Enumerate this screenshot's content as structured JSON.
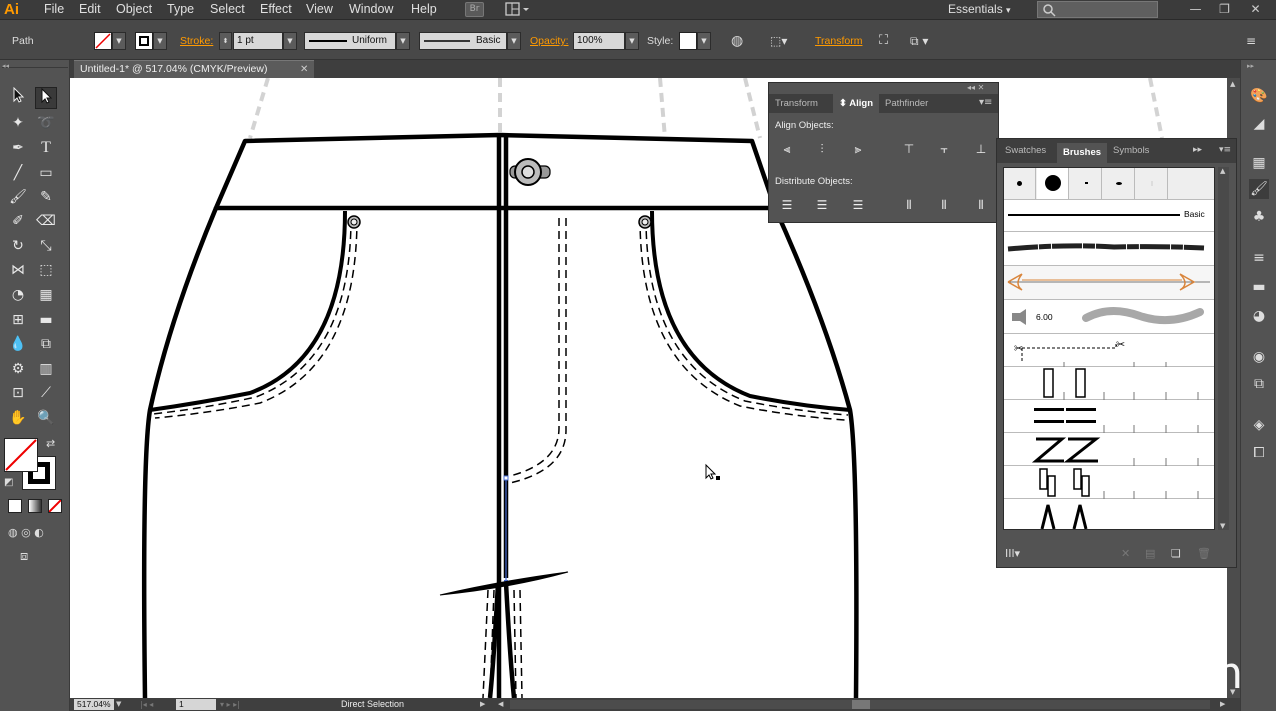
{
  "menubar": {
    "logo": "Ai",
    "items": [
      "File",
      "Edit",
      "Object",
      "Type",
      "Select",
      "Effect",
      "View",
      "Window",
      "Help"
    ],
    "bridge_badge": "Br",
    "workspace": "Essentials",
    "workspace_arrow": "▾",
    "win_minimize": "—",
    "win_restore": "❐",
    "win_close": "✕"
  },
  "controlbar": {
    "selection_type": "Path",
    "stroke_label": "Stroke:",
    "stroke_weight": "1 pt",
    "profile": "Uniform",
    "brush": "Basic",
    "opacity_label": "Opacity:",
    "opacity_value": "100%",
    "style_label": "Style:",
    "transform_link": "Transform"
  },
  "document": {
    "tab_title": "Untitled-1* @ 517.04% (CMYK/Preview)",
    "close": "✕"
  },
  "status": {
    "zoom": "517.04%",
    "artboard": "1",
    "tool_name": "Direct Selection"
  },
  "align_panel": {
    "tabs": [
      "Transform",
      "Align",
      "Pathfinder"
    ],
    "active_tab": "Align",
    "align_objects_label": "Align Objects:",
    "distribute_objects_label": "Distribute Objects:"
  },
  "brushes_panel": {
    "tabs": [
      "Swatches",
      "Brushes",
      "Symbols"
    ],
    "active_tab": "Brushes",
    "basic_brush_label": "Basic",
    "bristle_size_label": "6.00"
  },
  "watermark": "lynda.com",
  "colors": {
    "accent_orange": "#ff9a00",
    "ui_dark": "#535353",
    "menu_bg": "#3b3b3b",
    "canvas": "#ffffff",
    "selection_blue": "#4a6fd6"
  }
}
